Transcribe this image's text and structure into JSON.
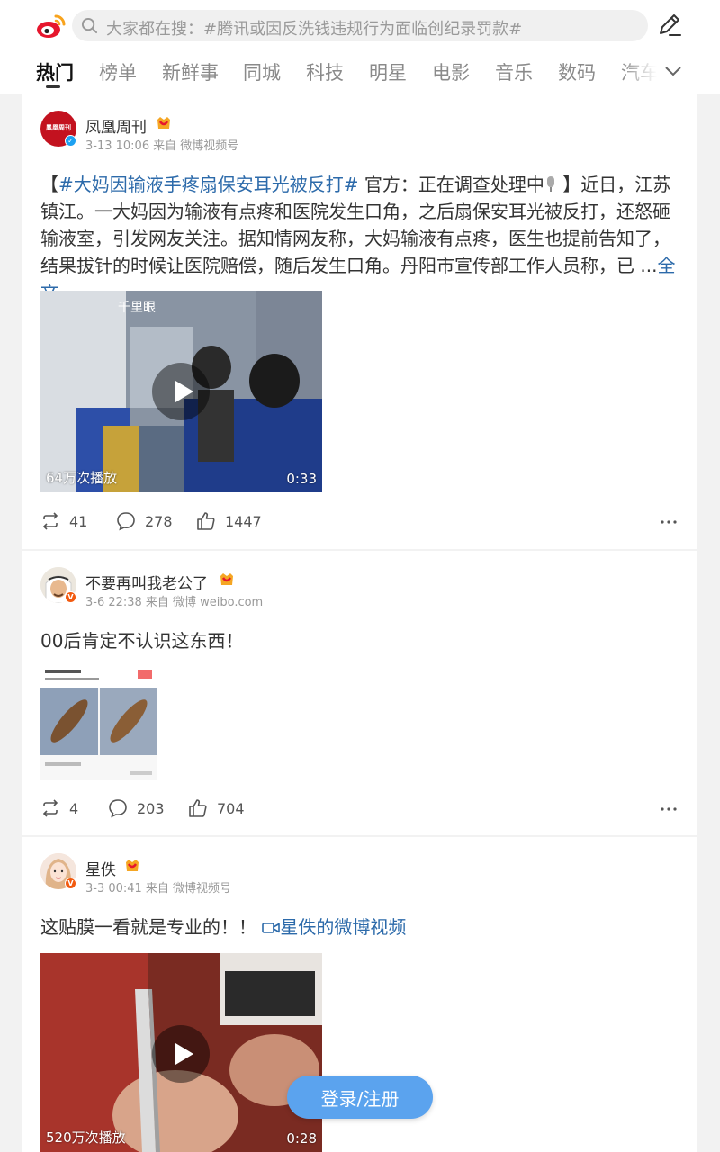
{
  "header": {
    "search_placeholder": "大家都在搜：#腾讯或因反洗钱违规行为面临创纪录罚款#"
  },
  "tabs": [
    {
      "label": "热门",
      "active": true
    },
    {
      "label": "榜单"
    },
    {
      "label": "新鲜事"
    },
    {
      "label": "同城"
    },
    {
      "label": "科技"
    },
    {
      "label": "明星"
    },
    {
      "label": "电影"
    },
    {
      "label": "音乐"
    },
    {
      "label": "数码"
    },
    {
      "label": "汽车"
    }
  ],
  "posts": [
    {
      "username": "凤凰周刊",
      "avatar_text": "鳳凰周刊",
      "verified": "blue",
      "time": "3-13 10:06",
      "source": "来自 微博视频号",
      "text_open": "【",
      "hashtag": "#大妈因输液手疼扇保安耳光被反打#",
      "text_body": " 官方：正在调查处理中",
      "text_after_emoji": " 】近日，江苏镇江。一大妈因为输液有点疼和医院发生口角，之后扇保安耳光被反打，还怒砸输液室，引发网友关注。据知情网友称，大妈输液有点疼，医生也提前告知了，结果拔针的时候让医院赔偿，随后发生口角。丹阳市宣传部工作人员称，已 ...",
      "full_text_link": "全文",
      "video": {
        "views": "64万次播放",
        "duration": "0:33",
        "watermark": "千里眼"
      },
      "reposts": "41",
      "comments": "278",
      "likes": "1447"
    },
    {
      "username": "不要再叫我老公了",
      "verified": "orange",
      "time": "3-6 22:38",
      "source": "来自 微博 weibo.com",
      "text": "00后肯定不认识这东西！",
      "reposts": "4",
      "comments": "203",
      "likes": "704"
    },
    {
      "username": "星佚",
      "verified": "orange",
      "time": "3-3 00:41",
      "source": "来自 微博视频号",
      "text": "这贴膜一看就是专业的！！",
      "video_link": "星佚的微博视频",
      "video": {
        "views": "520万次播放",
        "duration": "0:28"
      }
    }
  ],
  "login_button": "登录/注册",
  "colors": {
    "link": "#2c6aaa",
    "login_button": "#5ba3ee",
    "vip_badge": "#f5a623",
    "verified_blue": "#1da1f2",
    "verified_orange": "#f25a0f"
  }
}
